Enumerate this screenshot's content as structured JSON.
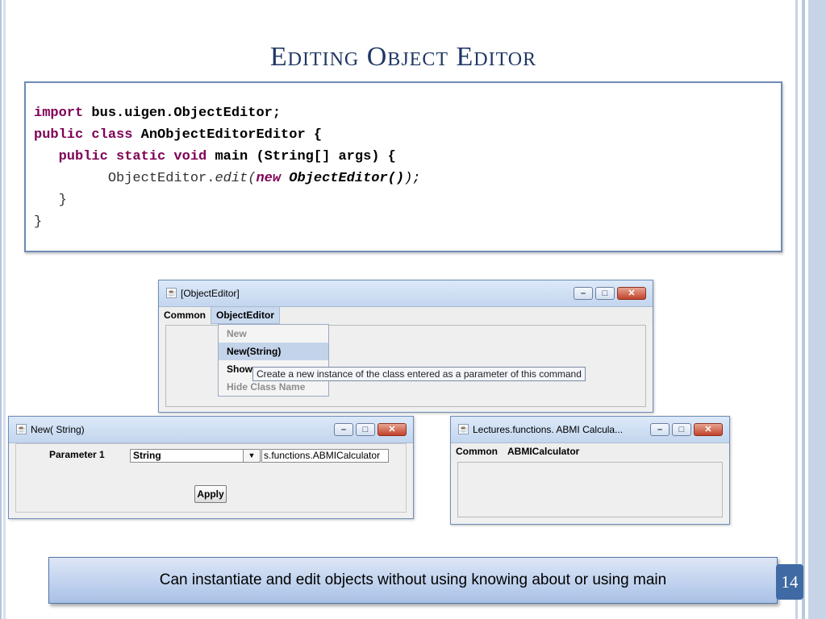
{
  "slide": {
    "title": "Editing Object Editor",
    "page_number": "14",
    "callout": "Can instantiate and edit objects without using knowing about or  using main"
  },
  "code": {
    "line1_kw": "import",
    "line1_rest": " bus.uigen.ObjectEditor;",
    "line2_kw": "public class",
    "line2_rest": " AnObjectEditorEditor {",
    "line3_indent": "   ",
    "line3_kw": "public static void",
    "line3_rest": " main (String[] args) {",
    "line4_plain": "         ObjectEditor.",
    "line4_italic": "edit(",
    "line4_kw": "new",
    "line4_bold": " ObjectEditor()",
    "line4_end": ");",
    "line5": "   }",
    "line6": "}"
  },
  "window_object_editor": {
    "title": "[ObjectEditor]",
    "menus": [
      "Common",
      "ObjectEditor"
    ],
    "dropdown_items": [
      "New",
      "New(String)",
      "Show",
      "Hide Class Name"
    ],
    "tooltip": "Create a new instance of the class entered as a parameter of this command"
  },
  "window_new_string": {
    "title": "New( String)",
    "param_label": "Parameter 1",
    "combo_value": "String",
    "text_value": "s.functions.ABMICalculator",
    "apply_label": "Apply"
  },
  "window_abmi": {
    "title": "Lectures.functions. ABMI Calcula...",
    "menus": [
      "Common",
      "ABMICalculator"
    ]
  },
  "icons": {
    "window_icon": "java-cup-icon",
    "minimize": "minimize-icon",
    "maximize": "maximize-icon",
    "close": "close-icon",
    "dropdown_arrow": "chevron-down-icon"
  }
}
